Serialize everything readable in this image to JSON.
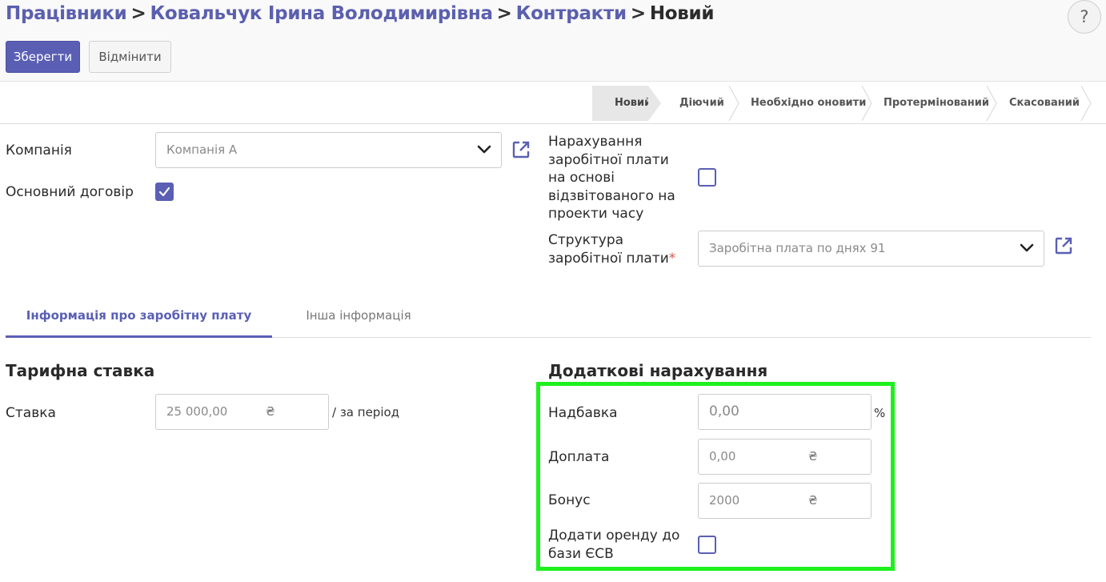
{
  "breadcrumb": {
    "items": [
      "Працівники",
      "Ковальчук Ірина Володимирівна",
      "Контракти"
    ],
    "current": "Новий",
    "separator": ">"
  },
  "help": {
    "label": "?"
  },
  "toolbar": {
    "save_label": "Зберегти",
    "cancel_label": "Відмінити"
  },
  "status": {
    "stages": [
      "Новий",
      "Діючий",
      "Необхідно оновити",
      "Протермінований",
      "Скасований"
    ],
    "active_index": 0
  },
  "form": {
    "company_label": "Компанія",
    "company_value": "Компанія А",
    "main_contract_label": "Основний договір",
    "main_contract_checked": true,
    "timesheet_label_lines": [
      "Нарахування",
      "заробітної плати",
      "на основі",
      "відзвітованого на",
      "проекти часу"
    ],
    "timesheet_checked": false,
    "structure_label_lines": [
      "Структура",
      "заробітної плати"
    ],
    "structure_required_mark": "*",
    "structure_value": "Заробітна плата по днях 91"
  },
  "tabs": [
    {
      "label": "Інформація про заробітну плату",
      "active": true
    },
    {
      "label": "Інша інформація",
      "active": false
    }
  ],
  "wage": {
    "title": "Тарифна ставка",
    "rate_label": "Ставка",
    "rate_value": "25 000,00",
    "rate_currency": "₴",
    "rate_suffix": "/ за період"
  },
  "extra": {
    "title": "Додаткові нарахування",
    "allowance_label": "Надбавка",
    "allowance_value": "0,00",
    "allowance_suffix": "%",
    "surcharge_label": "Доплата",
    "surcharge_value": "0,00",
    "surcharge_currency": "₴",
    "bonus_label": "Бонус",
    "bonus_value": "2000",
    "bonus_currency": "₴",
    "rent_label_lines": [
      "Додати оренду до",
      "бази ЄСВ"
    ],
    "rent_checked": false
  },
  "colors": {
    "accent": "#5a5fb4",
    "highlight": "#1ef01e",
    "required": "#d9534f"
  }
}
